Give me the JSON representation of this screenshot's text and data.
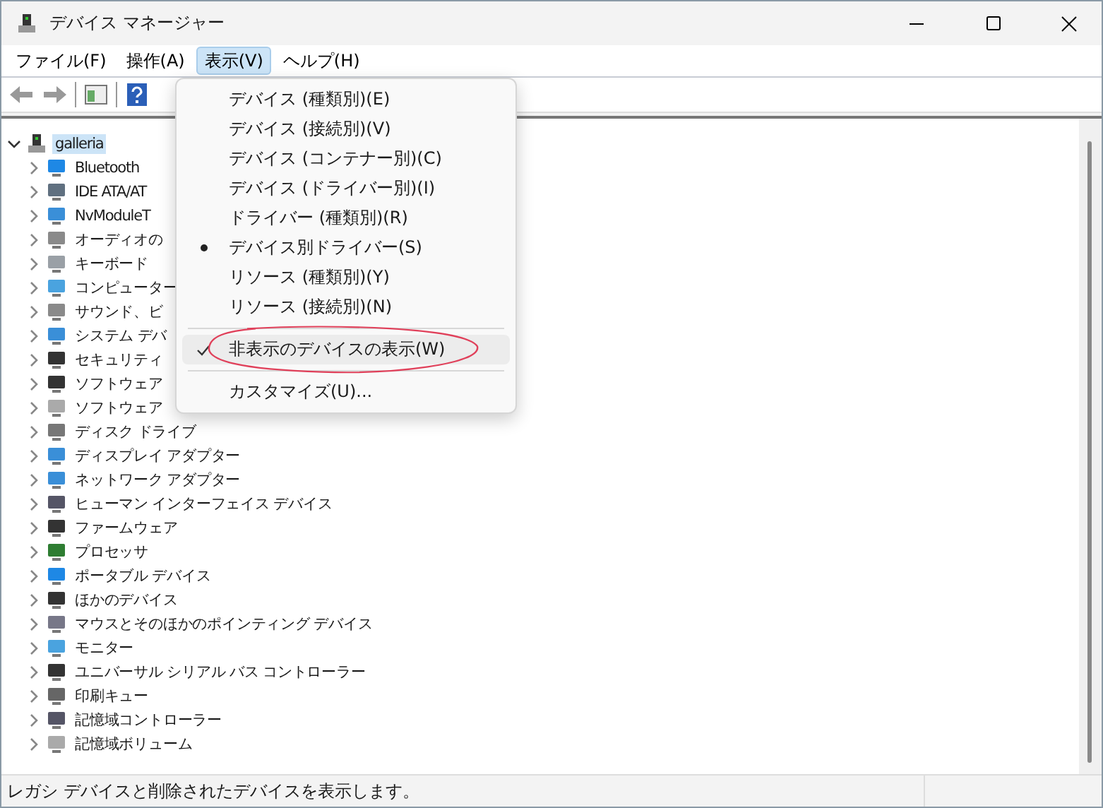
{
  "window": {
    "title": "デバイス マネージャー"
  },
  "menu_bar": [
    {
      "label": "ファイル(F)",
      "selected": false
    },
    {
      "label": "操作(A)",
      "selected": false
    },
    {
      "label": "表示(V)",
      "selected": true
    },
    {
      "label": "ヘルプ(H)",
      "selected": false
    }
  ],
  "tree": {
    "root": "galleria",
    "expanded": true,
    "children": [
      {
        "label": "Bluetooth"
      },
      {
        "label": "IDE ATA/AT"
      },
      {
        "label": "NvModuleT"
      },
      {
        "label": "オーディオの"
      },
      {
        "label": "キーボード"
      },
      {
        "label": "コンピューター"
      },
      {
        "label": "サウンド、ビ"
      },
      {
        "label": "システム デバ"
      },
      {
        "label": "セキュリティ"
      },
      {
        "label": "ソフトウェア"
      },
      {
        "label": "ソフトウェア"
      },
      {
        "label": "ディスク ドライブ"
      },
      {
        "label": "ディスプレイ アダプター"
      },
      {
        "label": "ネットワーク アダプター"
      },
      {
        "label": "ヒューマン インターフェイス デバイス"
      },
      {
        "label": "ファームウェア"
      },
      {
        "label": "プロセッサ"
      },
      {
        "label": "ポータブル デバイス"
      },
      {
        "label": "ほかのデバイス"
      },
      {
        "label": "マウスとそのほかのポインティング デバイス"
      },
      {
        "label": "モニター"
      },
      {
        "label": "ユニバーサル シリアル バス コントローラー"
      },
      {
        "label": "印刷キュー"
      },
      {
        "label": "記憶域コントローラー"
      },
      {
        "label": "記憶域ボリューム"
      }
    ]
  },
  "view_menu": [
    {
      "kind": "radio",
      "label": "デバイス (種類別)(E)",
      "checked": false,
      "selected": false
    },
    {
      "kind": "radio",
      "label": "デバイス (接続別)(V)",
      "checked": false,
      "selected": false
    },
    {
      "kind": "radio",
      "label": "デバイス (コンテナー別)(C)",
      "checked": false,
      "selected": false
    },
    {
      "kind": "radio",
      "label": "デバイス (ドライバー別)(I)",
      "checked": false,
      "selected": false
    },
    {
      "kind": "radio",
      "label": "ドライバー (種類別)(R)",
      "checked": false,
      "selected": false
    },
    {
      "kind": "radio",
      "label": "デバイス別ドライバー(S)",
      "checked": true,
      "selected": false
    },
    {
      "kind": "radio",
      "label": "リソース (種類別)(Y)",
      "checked": false,
      "selected": false
    },
    {
      "kind": "radio",
      "label": "リソース (接続別)(N)",
      "checked": false,
      "selected": false
    },
    {
      "kind": "separator"
    },
    {
      "kind": "check",
      "label": "非表示のデバイスの表示(W)",
      "checked": true,
      "selected": true
    },
    {
      "kind": "separator"
    },
    {
      "kind": "command",
      "label": "カスタマイズ(U)...",
      "selected": false
    }
  ],
  "status_bar": "レガシ デバイスと削除されたデバイスを表示します。"
}
